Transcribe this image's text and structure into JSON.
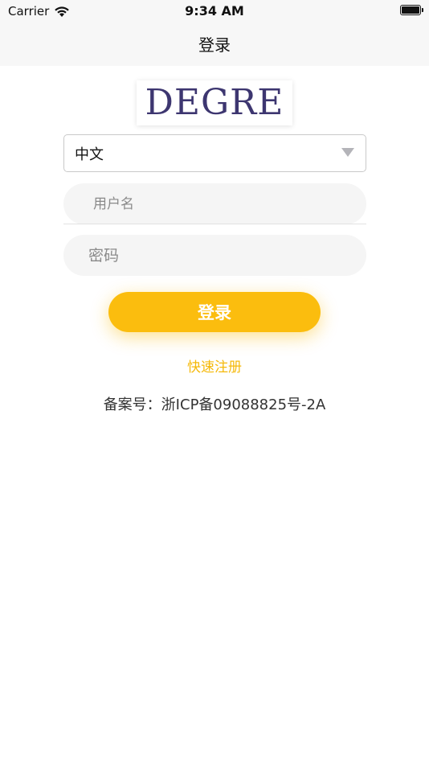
{
  "status_bar": {
    "carrier": "Carrier",
    "time": "9:34 AM"
  },
  "nav": {
    "title": "登录"
  },
  "logo": {
    "text": "DEGRE",
    "color": "#3d3670"
  },
  "language_select": {
    "value": "中文"
  },
  "form": {
    "username_placeholder": "用户名",
    "password_placeholder": "密码",
    "login_label": "登录"
  },
  "register_link": "快速注册",
  "icp_text": "备案号：浙ICP备09088825号-2A",
  "colors": {
    "accent": "#fbbd0e",
    "link": "#f5b90a",
    "field_bg": "#f5f5f5"
  },
  "icons": {
    "wifi": "wifi-icon",
    "battery": "battery-icon",
    "dropdown": "chevron-down-icon"
  }
}
